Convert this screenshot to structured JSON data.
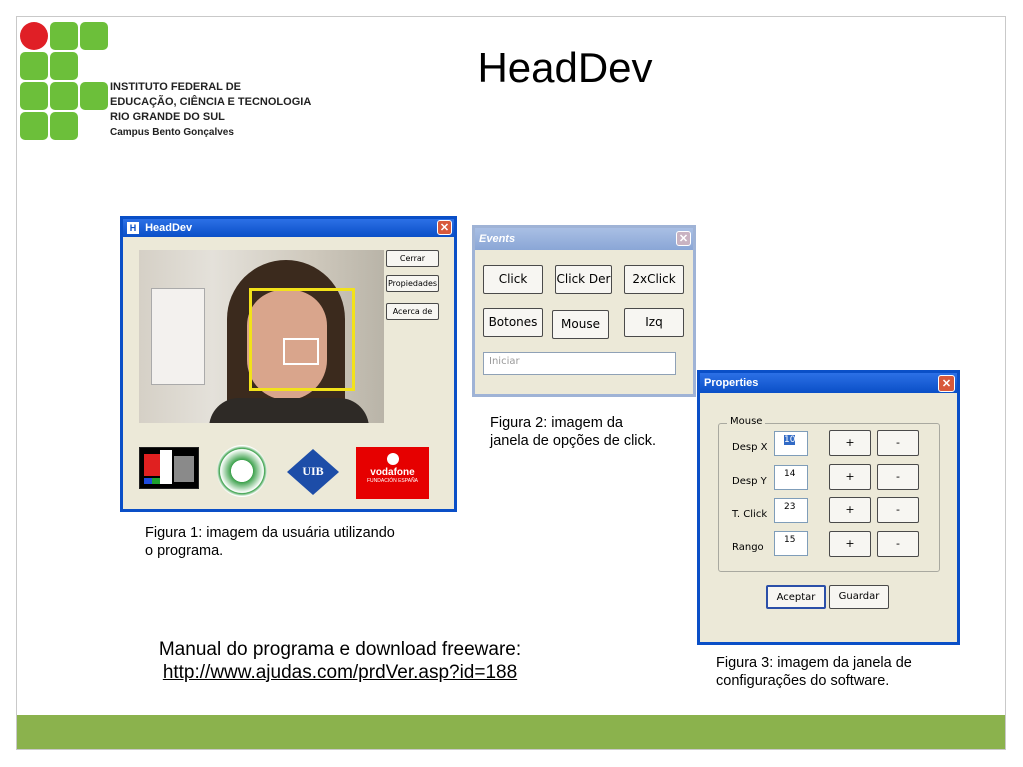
{
  "slide": {
    "title": "HeadDev",
    "institution": {
      "line1": "INSTITUTO FEDERAL DE",
      "line2": "EDUCAÇÃO, CIÊNCIA E TECNOLOGIA",
      "line3": "RIO GRANDE DO SUL",
      "line4": "Campus Bento Gonçalves"
    },
    "captions": {
      "fig1": "Figura 1: imagem da usuária utilizando o programa.",
      "fig2": "Figura 2: imagem da janela de opções de click.",
      "fig3": "Figura 3: imagem da janela de configurações do software."
    },
    "manual": {
      "text": "Manual do programa e download freeware:",
      "link": "http://www.ajudas.com/prdVer.asp?id=188"
    },
    "colors": {
      "accent_green": "#8bb24d",
      "logo_red": "#e01f26",
      "logo_green": "#6cbf3a"
    }
  },
  "headdev_window": {
    "title": "HeadDev",
    "buttons": {
      "close": "Cerrar",
      "properties": "Propiedades",
      "about": "Acerca de"
    },
    "sponsor_logos": [
      "ACAG RV",
      "Fundación",
      "UIB",
      "vodafone"
    ],
    "vodafone_text": "vodafone",
    "vodafone_sub": "FUNDACIÓN ESPAÑA",
    "uib_text": "UIB"
  },
  "events_window": {
    "title": "Events",
    "buttons": {
      "click": "Click",
      "click_der": "Click Der",
      "double_click": "2xClick",
      "botones": "Botones",
      "mouse": "Mouse",
      "izq": "Izq"
    },
    "status_placeholder": "Iniciar"
  },
  "properties_window": {
    "title": "Properties",
    "group_label": "Mouse",
    "rows": [
      {
        "label": "Desp X",
        "value": "10",
        "plus": "+",
        "minus": "-"
      },
      {
        "label": "Desp Y",
        "value": "14",
        "plus": "+",
        "minus": "-"
      },
      {
        "label": "T. Click",
        "value": "23",
        "plus": "+",
        "minus": "-"
      },
      {
        "label": "Rango",
        "value": "15",
        "plus": "+",
        "minus": "-"
      }
    ],
    "buttons": {
      "accept": "Aceptar",
      "save": "Guardar"
    }
  }
}
